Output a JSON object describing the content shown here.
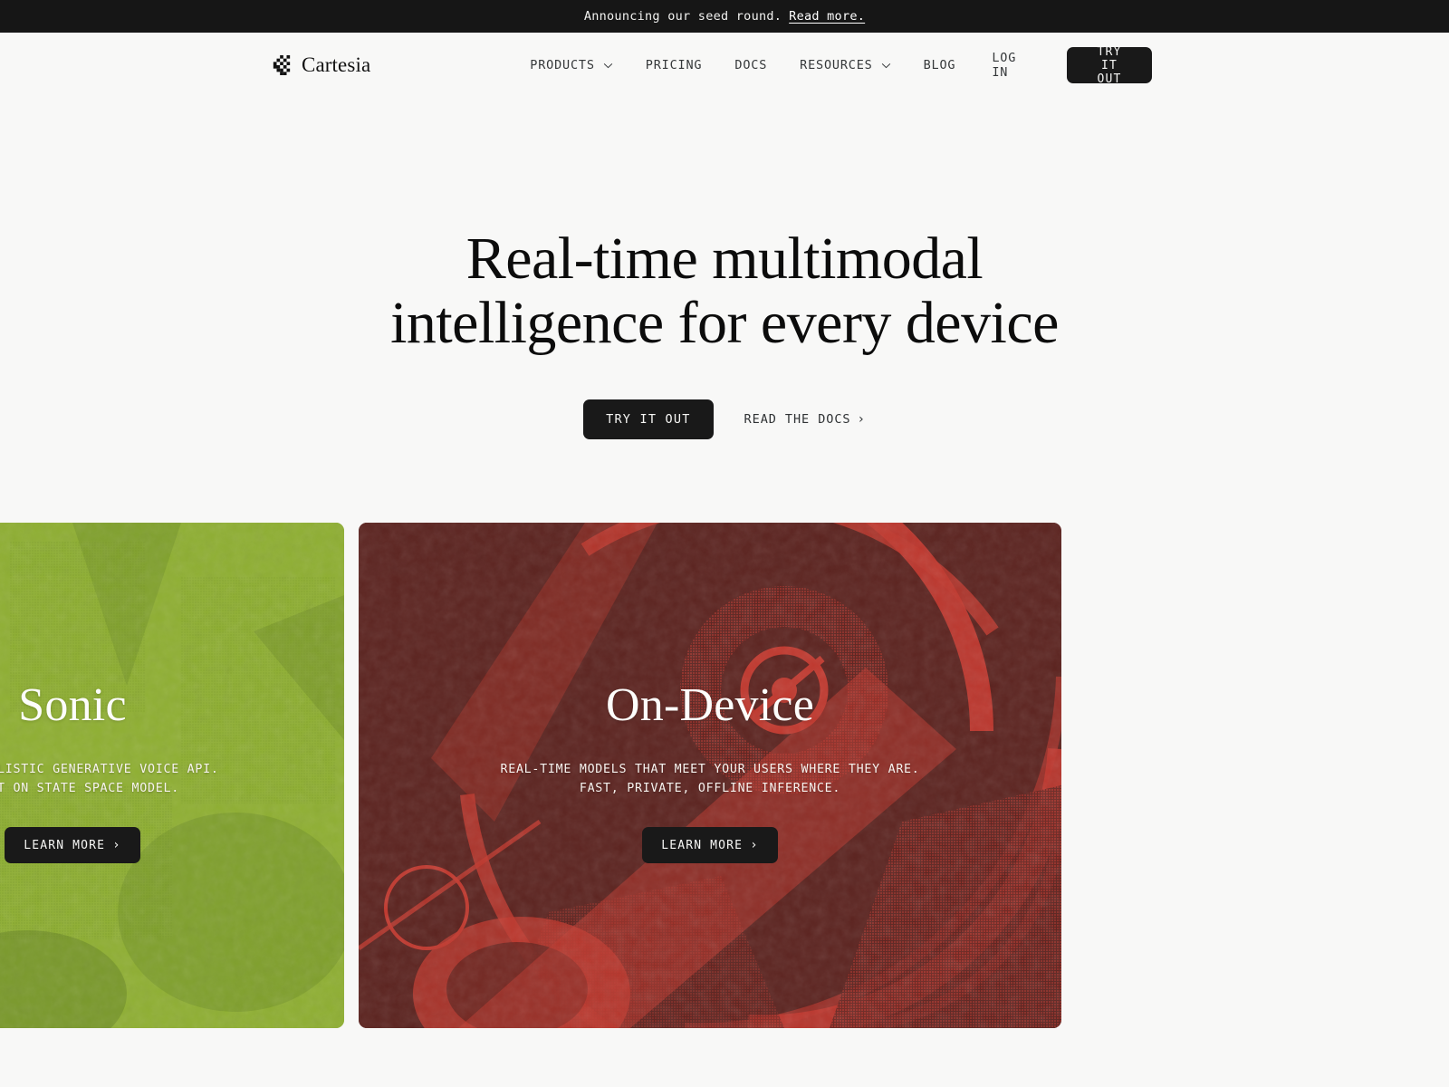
{
  "announcement": {
    "text": "Announcing our seed round.",
    "link_label": "Read more.",
    "bg": "#161616"
  },
  "nav": {
    "brand": {
      "name": "Cartesia",
      "mark_icon": "cartesia-pixel-logo"
    },
    "links": [
      {
        "label": "PRODUCTS",
        "has_dropdown": true
      },
      {
        "label": "PRICING",
        "has_dropdown": false
      },
      {
        "label": "DOCS",
        "has_dropdown": false
      },
      {
        "label": "RESOURCES",
        "has_dropdown": true
      },
      {
        "label": "BLOG",
        "has_dropdown": false
      }
    ],
    "login_label": "LOG IN",
    "cta_label": "TRY IT OUT"
  },
  "hero": {
    "title_line1": "Real-time multimodal",
    "title_line2": "intelligence for every device",
    "primary_cta": "TRY IT OUT",
    "secondary_cta": "READ THE DOCS",
    "secondary_arrow": "›"
  },
  "cards": [
    {
      "id": "sonic",
      "title": "Sonic",
      "subtitle_line1": "ULTRA-REALISTIC GENERATIVE VOICE API.",
      "subtitle_line2": "BUILT ON STATE SPACE MODEL.",
      "cta_label": "LEARN MORE",
      "cta_arrow": "›",
      "color": "#8faf33",
      "accent": "#3c5718"
    },
    {
      "id": "on-device",
      "title": "On-Device",
      "subtitle_line1": "REAL-TIME MODELS THAT MEET YOUR USERS WHERE THEY ARE.",
      "subtitle_line2": "FAST, PRIVATE, OFFLINE INFERENCE.",
      "cta_label": "LEARN MORE",
      "cta_arrow": "›",
      "color": "#5c2420",
      "accent": "#c0392f"
    }
  ],
  "theme": {
    "background": "#f8f8f7",
    "ink": "#111111",
    "button_dark": "#191919"
  }
}
